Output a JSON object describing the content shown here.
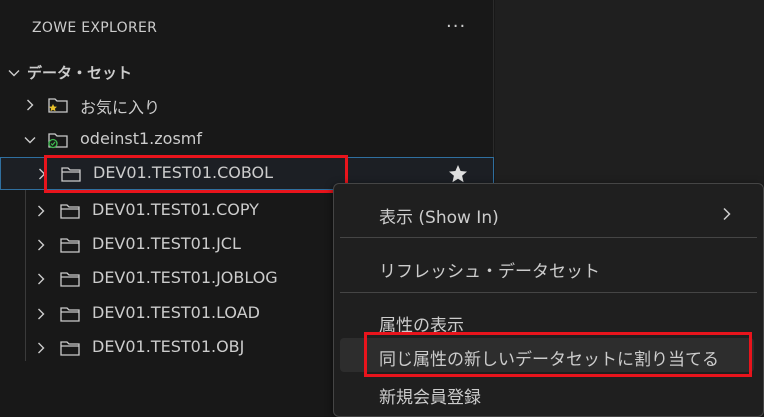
{
  "header": {
    "title": "ZOWE EXPLORER",
    "more_label": "···"
  },
  "section": {
    "title": "データ・セット"
  },
  "favorites": {
    "label": "お気に入り"
  },
  "profile": {
    "label": "odeinst1.zosmf"
  },
  "datasets": [
    {
      "label": "DEV01.TEST01.COBOL"
    },
    {
      "label": "DEV01.TEST01.COPY"
    },
    {
      "label": "DEV01.TEST01.JCL"
    },
    {
      "label": "DEV01.TEST01.JOBLOG"
    },
    {
      "label": "DEV01.TEST01.LOAD"
    },
    {
      "label": "DEV01.TEST01.OBJ"
    }
  ],
  "context_menu": {
    "items": [
      {
        "label": "表示 (Show In)"
      },
      {
        "label": "リフレッシュ・データセット"
      },
      {
        "label": "属性の表示"
      },
      {
        "label": "同じ属性の新しいデータセットに割り当てる"
      },
      {
        "label": "新規会員登録"
      }
    ]
  },
  "colors": {
    "highlight_box": "#e8141c",
    "favorite_star": "#e8c12a",
    "status_green": "#3fb950"
  }
}
